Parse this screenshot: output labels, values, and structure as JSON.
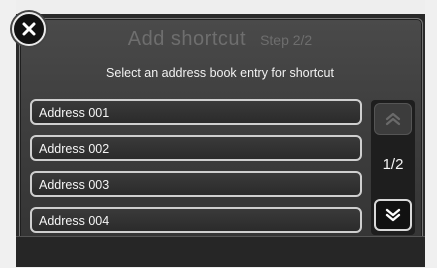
{
  "header": {
    "title": "Add shortcut",
    "step": "Step 2/2",
    "subtitle": "Select an address book entry for shortcut"
  },
  "close_icon": "close-icon",
  "entries": [
    {
      "label": "Address 001"
    },
    {
      "label": "Address 002"
    },
    {
      "label": "Address 003"
    },
    {
      "label": "Address 004"
    }
  ],
  "pager": {
    "page_indicator": "1/2",
    "up_icon": "double-chevron-up-icon",
    "down_icon": "double-chevron-down-icon"
  },
  "colors": {
    "panel": "#3f3f3f",
    "text": "#f5f5f5",
    "disabled_text": "#6e6e6e",
    "button_border": "#cfcfcf"
  }
}
